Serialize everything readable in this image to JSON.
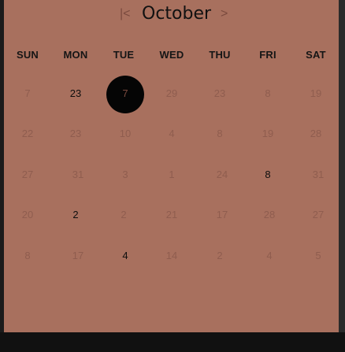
{
  "calendar": {
    "month": "October",
    "nav_first": "|<",
    "nav_next": ">",
    "weekdays": [
      "SUN",
      "MON",
      "TUE",
      "WED",
      "THU",
      "FRI",
      "SAT"
    ],
    "weeks": [
      [
        "7",
        "23",
        "7",
        "29",
        "23",
        "8",
        "19"
      ],
      [
        "22",
        "23",
        "10",
        "4",
        "8",
        "19",
        "28"
      ],
      [
        "27",
        "31",
        "3",
        "1",
        "24",
        "8",
        "31"
      ],
      [
        "20",
        "2",
        "2",
        "21",
        "17",
        "28",
        "27"
      ],
      [
        "8",
        "17",
        "4",
        "14",
        "2",
        "4",
        "5"
      ]
    ],
    "selected": {
      "week": 0,
      "day": 2
    },
    "emphasized": [
      [
        0,
        1
      ],
      [
        2,
        5
      ],
      [
        3,
        1
      ],
      [
        4,
        2
      ]
    ]
  },
  "colors": {
    "panel": "#a8705e",
    "muted_text": "#8f5d4f",
    "strong_text": "#0e0e0e",
    "selected_circle": "#050505"
  }
}
